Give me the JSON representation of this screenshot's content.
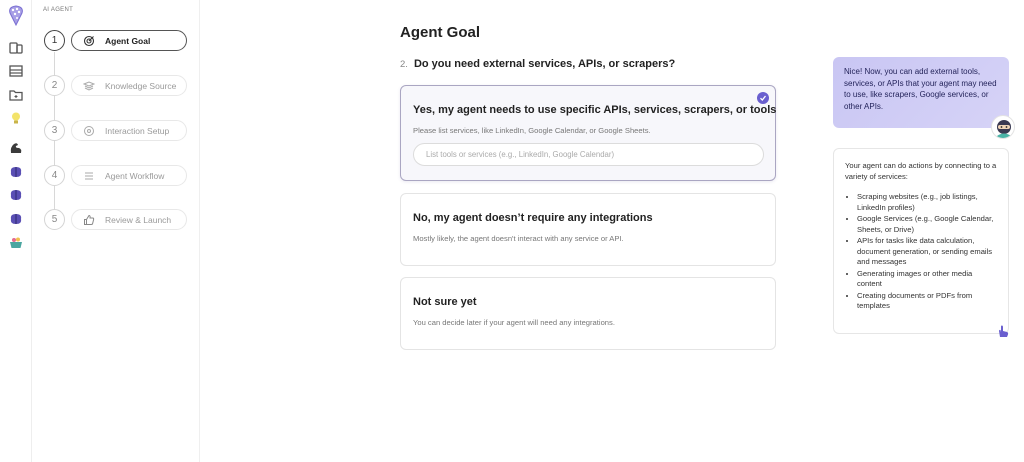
{
  "sidebar": {
    "header": "AI AGENT",
    "icons": [
      "brain-logo-icon",
      "library-icon",
      "table-icon",
      "folder-icon",
      "lightbulb-icon",
      "muscle-icon",
      "brain-icon",
      "brain-icon",
      "brain-icon",
      "basket-icon"
    ]
  },
  "steps": [
    {
      "number": "1",
      "label": "Agent Goal",
      "icon": "target-icon",
      "active": true
    },
    {
      "number": "2",
      "label": "Knowledge Source",
      "icon": "books-icon",
      "active": false
    },
    {
      "number": "3",
      "label": "Interaction Setup",
      "icon": "settings-icon",
      "active": false
    },
    {
      "number": "4",
      "label": "Agent Workflow",
      "icon": "list-icon",
      "active": false
    },
    {
      "number": "5",
      "label": "Review & Launch",
      "icon": "thumbs-up-icon",
      "active": false
    }
  ],
  "main": {
    "title": "Agent Goal",
    "question_number": "2.",
    "question": "Do you need external services, APIs, or scrapers?",
    "options": [
      {
        "title": "Yes, my agent needs to use specific APIs, services, scrapers, or tools",
        "description": "Please list services, like LinkedIn, Google Calendar, or Google Sheets.",
        "selected": true,
        "input_placeholder": "List tools or services (e.g., LinkedIn, Google Calendar)",
        "input_value": ""
      },
      {
        "title": "No, my agent doesn’t require any integrations",
        "description": "Mostly likely, the agent doesn't interact with any service or API.",
        "selected": false
      },
      {
        "title": "Not sure yet",
        "description": "You can decide later if your agent will need any integrations.",
        "selected": false
      }
    ]
  },
  "assistant": {
    "message": "Nice! Now, you can add external tools, services, or APIs that your agent may need to use, like scrapers, Google services, or other APIs.",
    "info_intro": "Your agent can do actions by connecting to a variety of services:",
    "info_items": [
      "Scraping websites (e.g., job listings, LinkedIn profiles)",
      "Google Services (e.g., Google Calendar, Sheets, or Drive)",
      "APIs for tasks like data calculation, document generation, or sending emails and messages",
      "Generating images or other media content",
      "Creating documents or PDFs from templates"
    ]
  },
  "colors": {
    "accent": "#6a5fcf",
    "assistant_bubble": "#c9c6f3",
    "selected_border": "#aaa6c2"
  }
}
